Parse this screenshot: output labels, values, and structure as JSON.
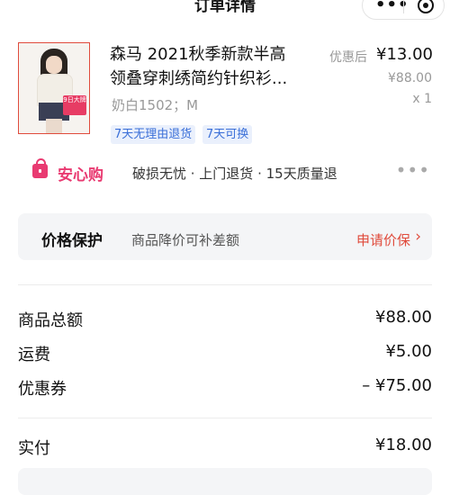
{
  "header": {
    "title": "订单详情",
    "more_icon": "more-dots-icon",
    "close_icon": "target-icon",
    "more_text": "•••"
  },
  "product": {
    "title_line1": "森马 2021秋季新款半高",
    "title_line2": "领叠穿刺绣简约针织衫...",
    "variant": "奶白1502；M",
    "discount_label": "优惠后",
    "price_now": "¥13.00",
    "price_original": "¥88.00",
    "quantity": "x 1",
    "thumb_tag": "9日大牌",
    "tags": [
      "7天无理由退货",
      "7天可换"
    ]
  },
  "assurance": {
    "title": "安心购",
    "desc": "破损无忧 · 上门退货 · 15天质量退",
    "more": "•••"
  },
  "price_protect": {
    "title": "价格保护",
    "desc": "商品降价可补差额",
    "action": "申请价保",
    "chevron": "›"
  },
  "summary": [
    {
      "label": "商品总额",
      "value": "¥88.00"
    },
    {
      "label": "运费",
      "value": "¥5.00"
    },
    {
      "label": "优惠券",
      "value": "– ¥75.00"
    }
  ],
  "paid": {
    "label": "实付",
    "value": "¥18.00"
  },
  "colors": {
    "accent_pink": "#e93a71",
    "accent_red": "#e04b3c",
    "tag_blue": "#3a6fd8"
  }
}
